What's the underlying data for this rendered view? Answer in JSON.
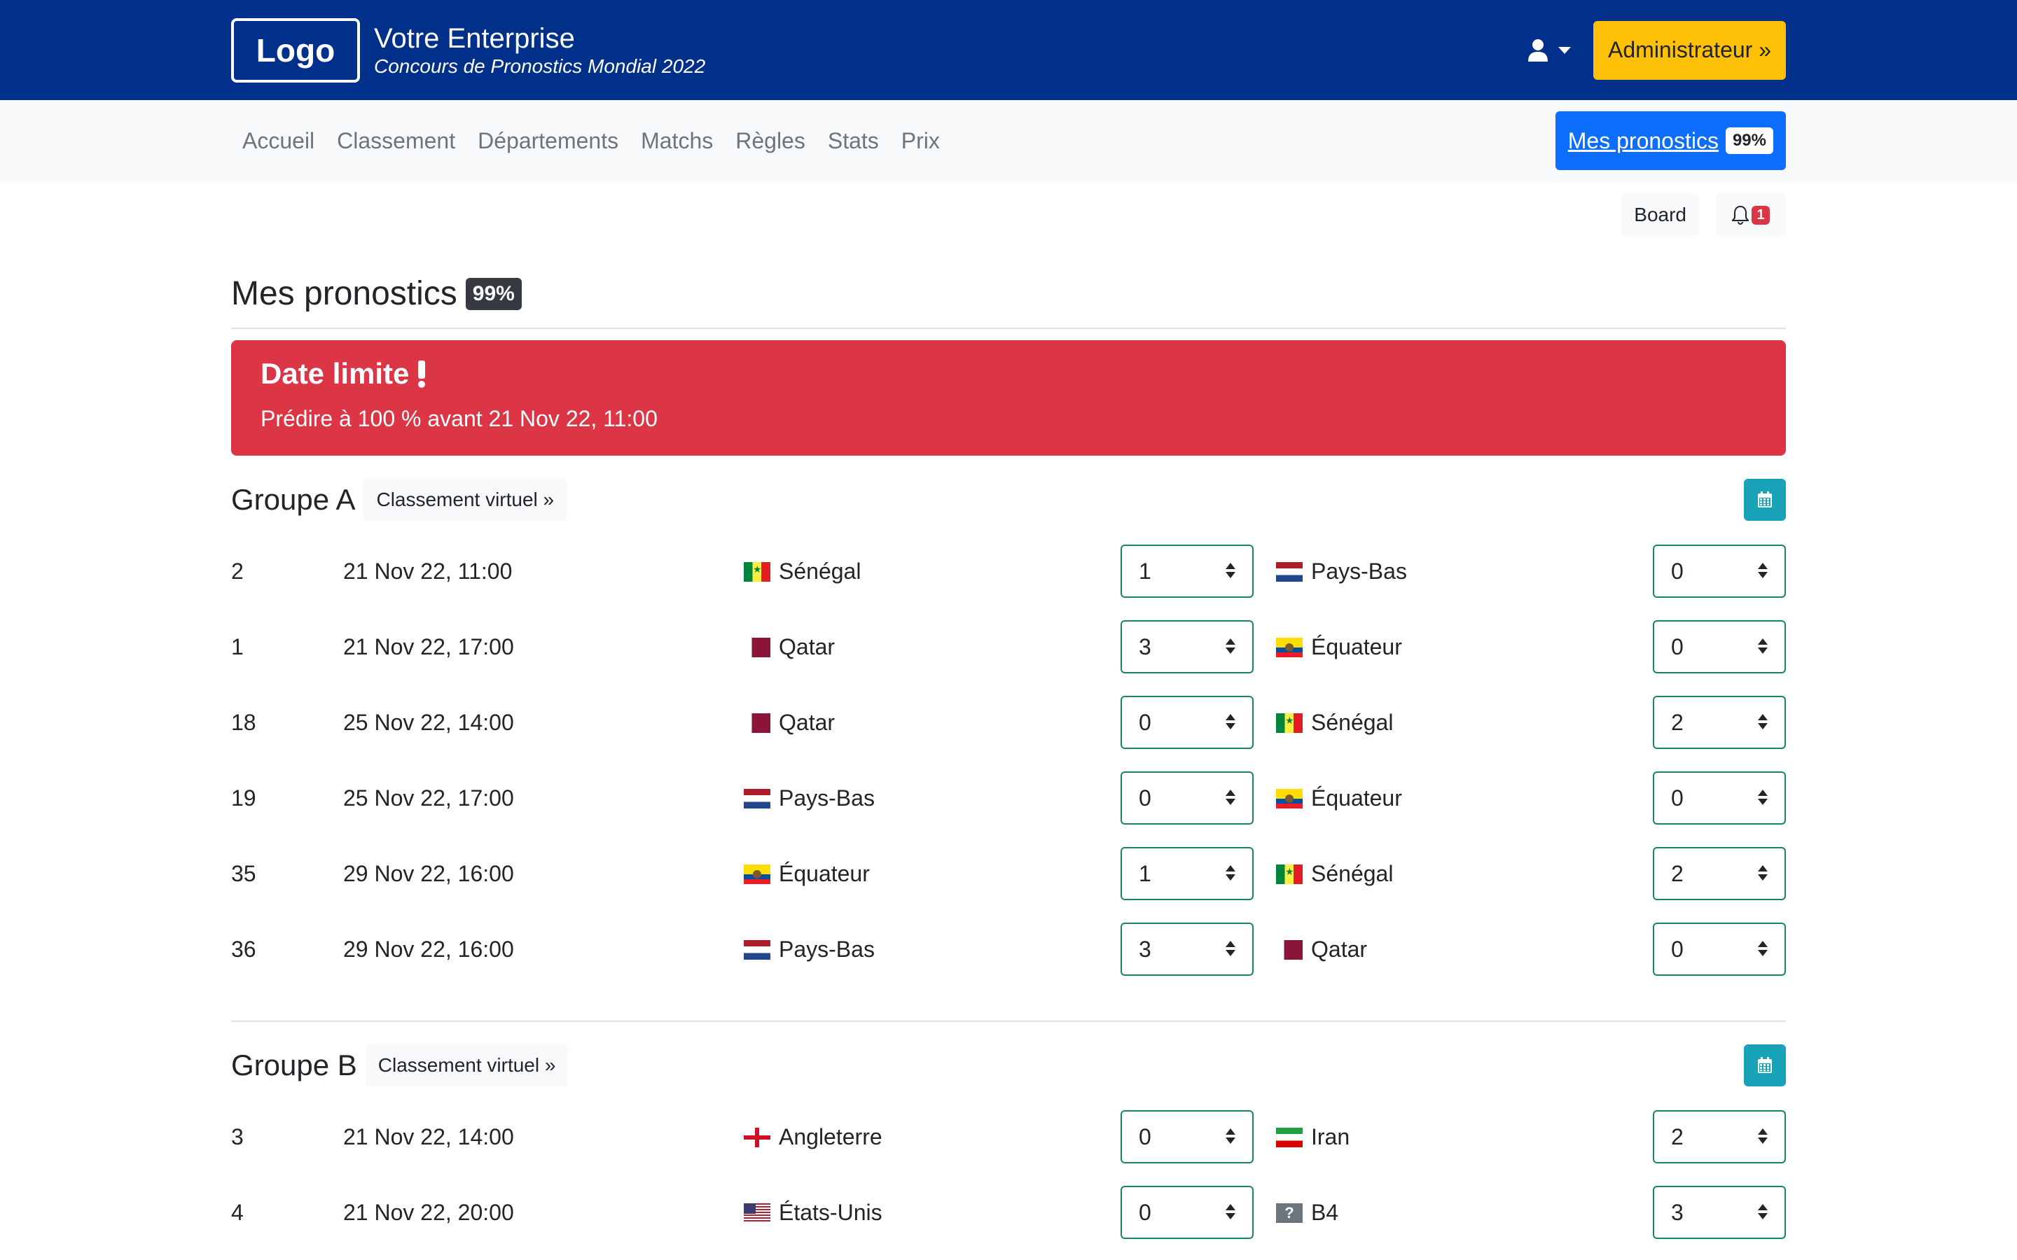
{
  "header": {
    "logo": "Logo",
    "company": "Votre Enterprise",
    "subtitle": "Concours de Pronostics Mondial 2022",
    "admin_button": "Administrateur »"
  },
  "nav": {
    "items": [
      "Accueil",
      "Classement",
      "Départements",
      "Matchs",
      "Règles",
      "Stats",
      "Prix"
    ],
    "my_predictions": "Mes pronostics",
    "my_predictions_badge": "99%"
  },
  "actions": {
    "board": "Board",
    "notifications_count": "1"
  },
  "page": {
    "title": "Mes pronostics",
    "badge": "99%"
  },
  "alert": {
    "title": "Date limite",
    "text": "Prédire à 100 % avant 21 Nov 22, 11:00"
  },
  "virtual_ranking_label": "Classement virtuel »",
  "groups": [
    {
      "name": "Groupe A",
      "matches": [
        {
          "num": "2",
          "date": "21 Nov 22, 11:00",
          "home": "Sénégal",
          "home_flag": "senegal",
          "home_score": "1",
          "away": "Pays-Bas",
          "away_flag": "nl",
          "away_score": "0"
        },
        {
          "num": "1",
          "date": "21 Nov 22, 17:00",
          "home": "Qatar",
          "home_flag": "qatar",
          "home_score": "3",
          "away": "Équateur",
          "away_flag": "ec",
          "away_score": "0"
        },
        {
          "num": "18",
          "date": "25 Nov 22, 14:00",
          "home": "Qatar",
          "home_flag": "qatar",
          "home_score": "0",
          "away": "Sénégal",
          "away_flag": "senegal",
          "away_score": "2"
        },
        {
          "num": "19",
          "date": "25 Nov 22, 17:00",
          "home": "Pays-Bas",
          "home_flag": "nl",
          "home_score": "0",
          "away": "Équateur",
          "away_flag": "ec",
          "away_score": "0"
        },
        {
          "num": "35",
          "date": "29 Nov 22, 16:00",
          "home": "Équateur",
          "home_flag": "ec",
          "home_score": "1",
          "away": "Sénégal",
          "away_flag": "senegal",
          "away_score": "2"
        },
        {
          "num": "36",
          "date": "29 Nov 22, 16:00",
          "home": "Pays-Bas",
          "home_flag": "nl",
          "home_score": "3",
          "away": "Qatar",
          "away_flag": "qatar",
          "away_score": "0"
        }
      ]
    },
    {
      "name": "Groupe B",
      "matches": [
        {
          "num": "3",
          "date": "21 Nov 22, 14:00",
          "home": "Angleterre",
          "home_flag": "eng",
          "home_score": "0",
          "away": "Iran",
          "away_flag": "iran",
          "away_score": "2"
        },
        {
          "num": "4",
          "date": "21 Nov 22, 20:00",
          "home": "États-Unis",
          "home_flag": "us",
          "home_score": "0",
          "away": "B4",
          "away_flag": "unk",
          "away_score": "3"
        }
      ]
    }
  ],
  "colors": {
    "header_bg": "#00308a",
    "admin_btn": "#ffc107",
    "primary": "#0d6efd",
    "alert": "#dc3545",
    "calendar_btn": "#17a2b8",
    "select_border": "#198754"
  }
}
